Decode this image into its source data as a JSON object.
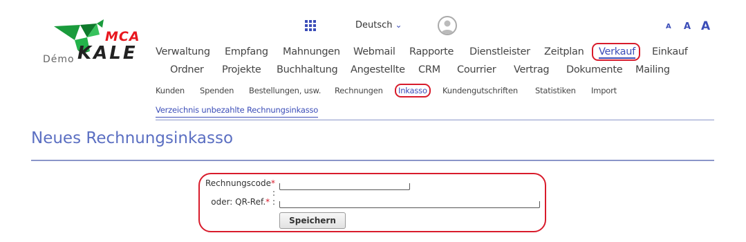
{
  "logo": {
    "demo": "Démo",
    "mca": "MCA",
    "kale": "KALE"
  },
  "header": {
    "language": "Deutsch",
    "font_sizes": [
      "A",
      "A",
      "A"
    ]
  },
  "main_menu": [
    "Verwaltung",
    "Empfang",
    "Mahnungen",
    "Webmail",
    "Rapporte",
    "Dienstleister",
    "Zeitplan",
    "Verkauf",
    "Einkauf",
    "Ordner",
    "Projekte",
    "Buchhaltung",
    "Angestellte",
    "CRM",
    "Courrier",
    "Vertrag",
    "Dokumente",
    "Mailing"
  ],
  "sub_menu": [
    "Kunden",
    "Spenden",
    "Bestellungen, usw.",
    "Rechnungen",
    "Inkasso",
    "Kundengutschriften",
    "Statistiken",
    "Import"
  ],
  "sub_menu2": "Verzeichnis unbezahlte Rechnungsinkasso",
  "page_title": "Neues Rechnungsinkasso",
  "form": {
    "invoice_code_label": "Rechnungscode",
    "qr_ref_label": "oder: QR-Ref.",
    "required_mark": "*",
    "colon": " :",
    "invoice_code_value": "",
    "qr_ref_value": "",
    "save_label": "Speichern"
  },
  "colors": {
    "accent": "#3b4db8",
    "highlight": "#d81b2b",
    "brand_green": "#1a9b3c"
  }
}
